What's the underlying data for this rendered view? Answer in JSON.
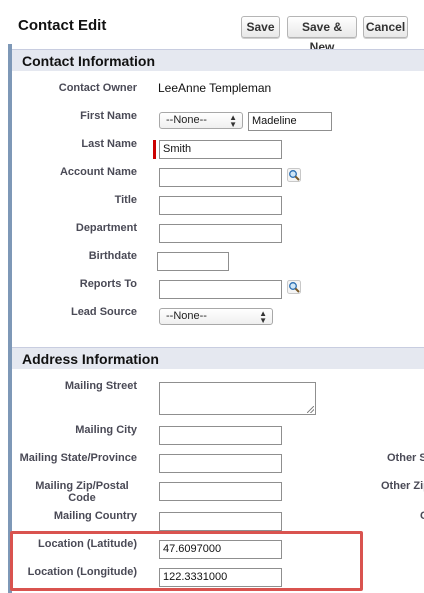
{
  "header": {
    "title": "Contact Edit",
    "buttons": {
      "save": "Save",
      "save_new": "Save & New",
      "cancel": "Cancel"
    }
  },
  "contact_info": {
    "section_title": "Contact Information",
    "owner_label": "Contact Owner",
    "owner_value": "LeeAnne Templeman",
    "first_name_label": "First Name",
    "salutation_value": "--None--",
    "first_name_value": "Madeline",
    "last_name_label": "Last Name",
    "last_name_value": "Smith",
    "account_name_label": "Account Name",
    "title_label": "Title",
    "department_label": "Department",
    "birthdate_label": "Birthdate",
    "reports_to_label": "Reports To",
    "lead_source_label": "Lead Source",
    "lead_source_value": "--None--"
  },
  "address_info": {
    "section_title": "Address Information",
    "mailing_street_label": "Mailing Street",
    "mailing_city_label": "Mailing City",
    "mailing_state_label": "Mailing State/Province",
    "mailing_zip_label_1": "Mailing Zip/Postal",
    "mailing_zip_label_2": "Code",
    "mailing_country_label": "Mailing Country",
    "latitude_label": "Location (Latitude)",
    "latitude_value": "47.6097000",
    "longitude_label": "Location (Longitude)",
    "longitude_value": "122.3331000",
    "other_state_label": "Other S",
    "other_zip_label": "Other Zip",
    "other_country_label": "C"
  },
  "colors": {
    "section_bg": "#e5e8f0",
    "required": "#cc0000",
    "highlight": "#d9534f"
  },
  "icons": {
    "lookup": "magnifier-lookup-icon",
    "select": "updown-arrows-icon",
    "resize": "resize-grip-icon"
  }
}
